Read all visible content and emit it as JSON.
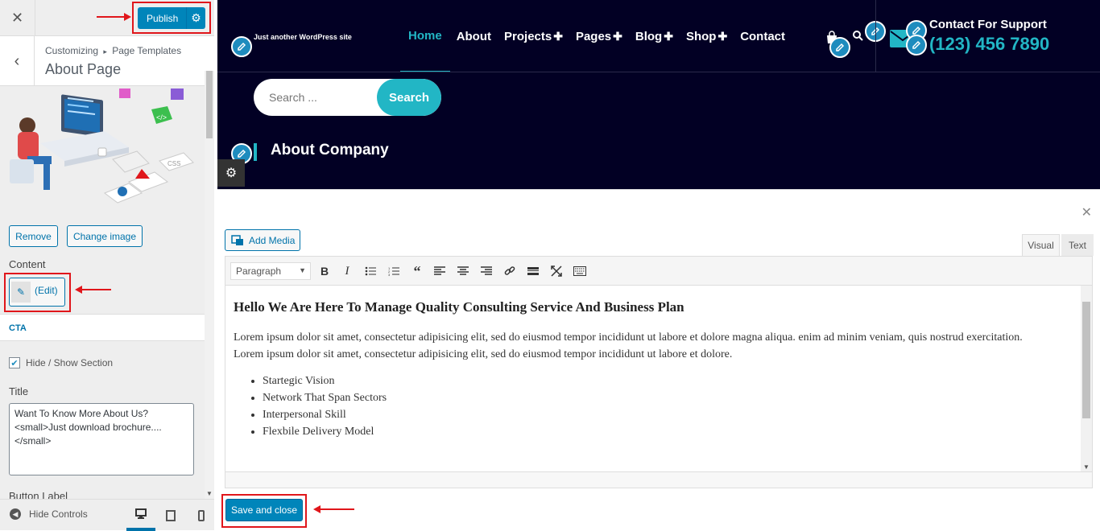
{
  "customizer": {
    "close_icon": "close-icon",
    "publish_label": "Publish",
    "breadcrumb_root": "Customizing",
    "breadcrumb_sep": "▸",
    "breadcrumb_section": "Page Templates",
    "panel_title": "About Page",
    "remove_label": "Remove",
    "change_image_label": "Change image",
    "content_label": "Content",
    "edit_label": "(Edit)",
    "cta_label": "CTA",
    "hide_show_label": "Hide / Show Section",
    "hide_show_checked": true,
    "title_label": "Title",
    "title_value": "Want To Know More About Us?\n<small>Just download brochure....\n</small>",
    "button_label_label": "Button Label",
    "hide_controls_label": "Hide Controls"
  },
  "site": {
    "tagline": "Just another WordPress site",
    "nav": [
      {
        "label": "Home",
        "active": true,
        "plus": ""
      },
      {
        "label": "About",
        "active": false,
        "plus": ""
      },
      {
        "label": "Projects",
        "active": false,
        "plus": "✚"
      },
      {
        "label": "Pages",
        "active": false,
        "plus": "✚"
      },
      {
        "label": "Blog",
        "active": false,
        "plus": "✚"
      },
      {
        "label": "Shop",
        "active": false,
        "plus": "✚"
      },
      {
        "label": "Contact",
        "active": false,
        "plus": ""
      }
    ],
    "support_title": "Contact For Support",
    "support_phone": "(123) 456 7890",
    "search_placeholder": "Search ...",
    "search_button": "Search",
    "section_title": "About Company"
  },
  "editor": {
    "add_media_label": "Add Media",
    "tab_visual": "Visual",
    "tab_text": "Text",
    "format_value": "Paragraph",
    "heading": "Hello We Are Here To Manage Quality Consulting Service And Business Plan",
    "para1": "Lorem ipsum dolor sit amet, consectetur adipisicing elit, sed do eiusmod tempor incididunt ut labore et dolore magna aliqua. enim ad minim veniam, quis nostrud exercitation.",
    "para2": "Lorem ipsum dolor sit amet, consectetur adipisicing elit, sed do eiusmod tempor incididunt ut labore et dolore.",
    "list": [
      "Startegic Vision",
      "Network That Span Sectors",
      "Interpersonal Skill",
      "Flexbile Delivery Model"
    ],
    "save_label": "Save and close"
  },
  "colors": {
    "accent": "#0085ba",
    "site_bg": "#020024",
    "site_accent": "#22b6c5",
    "highlight": "#e0161b"
  }
}
